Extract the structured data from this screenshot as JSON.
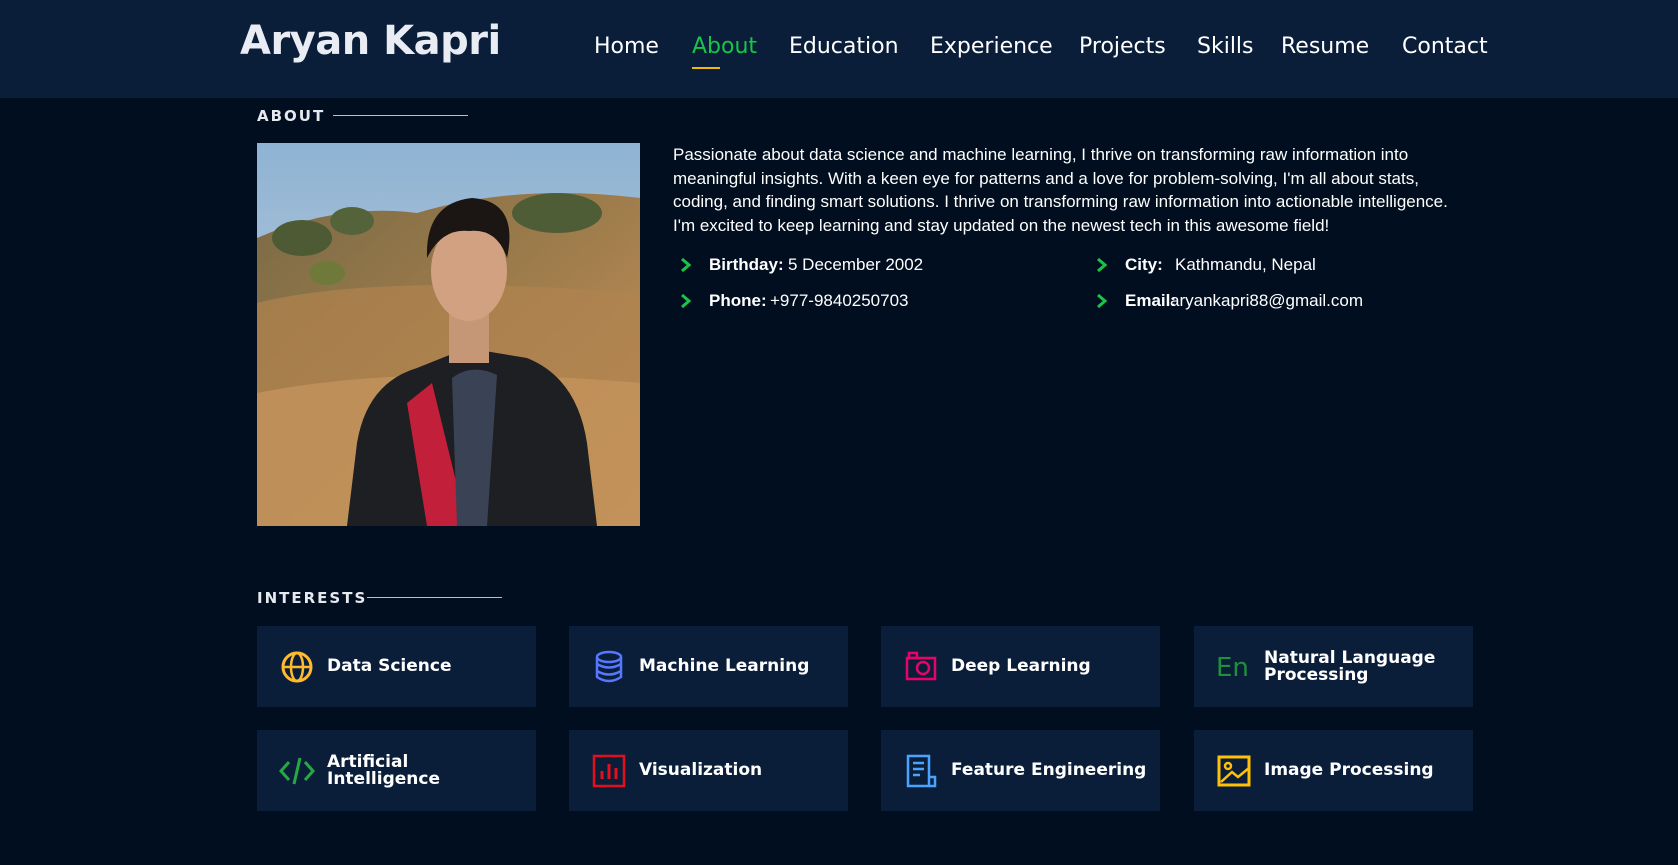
{
  "header": {
    "logo": "Aryan Kapri",
    "nav": [
      {
        "label": "Home"
      },
      {
        "label": "About"
      },
      {
        "label": "Education"
      },
      {
        "label": "Experience"
      },
      {
        "label": "Projects"
      },
      {
        "label": "Skills"
      },
      {
        "label": "Resume"
      },
      {
        "label": "Contact"
      }
    ],
    "active_nav": "About"
  },
  "about": {
    "heading": "ABOUT",
    "paragraph": "Passionate about data science and machine learning, I thrive on transforming raw information into meaningful insights. With a keen eye for patterns and a love for problem-solving, I'm all about stats, coding, and finding smart solutions. I thrive on transforming raw information into actionable intelligence. I'm excited to keep learning and stay updated on the newest tech in this awesome field!",
    "details": {
      "birthday": {
        "label": "Birthday:",
        "value": "5 December 2002"
      },
      "city": {
        "label": "City:",
        "value": "Kathmandu, Nepal"
      },
      "phone": {
        "label": "Phone:",
        "value": "+977-9840250703"
      },
      "email": {
        "label": "Email:",
        "value": "aryankapri88@gmail.com"
      }
    }
  },
  "interests": {
    "heading": "INTERESTS",
    "items": [
      {
        "label": "Data Science",
        "icon": "globe-icon",
        "color": "#ffbb2c"
      },
      {
        "label": "Machine Learning",
        "icon": "database-icon",
        "color": "#5578ff"
      },
      {
        "label": "Deep Learning",
        "icon": "camera-icon",
        "color": "#e80368"
      },
      {
        "label": "Natural Language Processing",
        "icon": "translate-icon",
        "color": "#1f8f3a"
      },
      {
        "label": "Artificial Intelligence",
        "icon": "code-icon",
        "color": "#28a745"
      },
      {
        "label": "Visualization",
        "icon": "bar-chart-icon",
        "color": "#e3101c"
      },
      {
        "label": "Feature Engineering",
        "icon": "document-icon",
        "color": "#4aa3ff"
      },
      {
        "label": "Image Processing",
        "icon": "image-icon",
        "color": "#ffc107"
      }
    ]
  },
  "colors": {
    "background": "#010e1f",
    "header_bg": "#0a1e3a",
    "card_bg": "#0a1e3a",
    "accent_green": "#19c44a",
    "accent_yellow": "#f2b705"
  }
}
